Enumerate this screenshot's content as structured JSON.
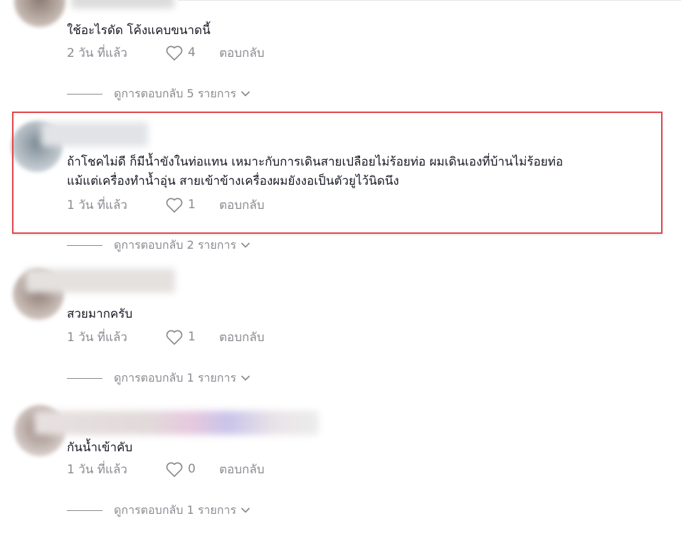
{
  "colors": {
    "highlight_border": "#e0474c",
    "text": "#161823",
    "muted": "#8a8b91"
  },
  "comments": [
    {
      "text_lines": [
        "ใช้อะไรดัด โค้งแคบขนาดนี้"
      ],
      "time": "2 วัน ที่แล้ว",
      "likes": "4",
      "reply_label": "ตอบกลับ",
      "view_replies": "ดูการตอบกลับ 5 รายการ"
    },
    {
      "text_lines": [
        "ถ้าโชคไม่ดี ก็มีน้ำขังในท่อแทน เหมาะกับการเดินสายเปลือยไม่ร้อยท่อ ผมเดินเองที่บ้านไม่ร้อยท่อ",
        "แม้แต่เครื่องทำน้ำอุ่น สายเข้าข้างเครื่องผมยังงอเป็นตัวยูไว้นิดนึง"
      ],
      "time": "1 วัน ที่แล้ว",
      "likes": "1",
      "reply_label": "ตอบกลับ",
      "view_replies": "ดูการตอบกลับ 2 รายการ",
      "highlighted": true
    },
    {
      "text_lines": [
        "สวยมากครับ"
      ],
      "time": "1 วัน ที่แล้ว",
      "likes": "1",
      "reply_label": "ตอบกลับ",
      "view_replies": "ดูการตอบกลับ 1 รายการ"
    },
    {
      "text_lines": [
        "กันน้ำเข้าคับ"
      ],
      "time": "1 วัน ที่แล้ว",
      "likes": "0",
      "reply_label": "ตอบกลับ",
      "view_replies": "ดูการตอบกลับ 1 รายการ"
    }
  ]
}
